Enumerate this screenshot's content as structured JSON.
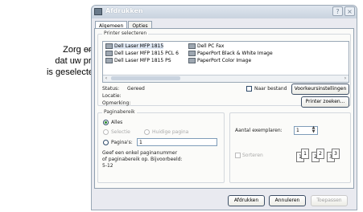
{
  "callout": {
    "lines": [
      "Zorg ervoor",
      "dat uw printer",
      "is geselecteerd."
    ]
  },
  "dialog": {
    "title": "Afdrukken",
    "help_label": "?",
    "close_label": "×",
    "tabs": [
      {
        "label": "Algemeen",
        "active": true
      },
      {
        "label": "Opties",
        "active": false
      }
    ],
    "printer_group": {
      "legend": "Printer selecteren",
      "printers": [
        "Dell Laser MFP 1815",
        "Dell Laser MFP 1815 PCL 6",
        "Dell Laser MFP 1815 PS",
        "Dell PC Fax",
        "PaperPort Black & White Image",
        "PaperPort Color Image"
      ],
      "selected": "Dell Laser MFP 1815"
    },
    "status": {
      "status_label": "Status:",
      "status_value": "Gereed",
      "location_label": "Locatie:",
      "location_value": "",
      "comment_label": "Opmerking:",
      "comment_value": ""
    },
    "print_to_file_label": "Naar bestand",
    "preferences_button": "Voorkeursinstellingen",
    "find_printer_button": "Printer zoeken...",
    "page_range": {
      "legend": "Paginabereik",
      "all_label": "Alles",
      "selection_label": "Selectie",
      "current_page_label": "Huidige pagina",
      "pages_label": "Pagina's:",
      "pages_value": "1",
      "hint": "Geef een enkel paginanummer of paginabereik op. Bijvoorbeeld: 5-12"
    },
    "copies": {
      "label": "Aantal exemplaren:",
      "value": "1",
      "collate_label": "Sorteren"
    },
    "buttons": {
      "print": "Afdrukken",
      "cancel": "Annuleren",
      "apply": "Toepassen"
    },
    "colors": {
      "title_bar": "#d3dbe6",
      "panel": "#fbfbf9"
    }
  }
}
